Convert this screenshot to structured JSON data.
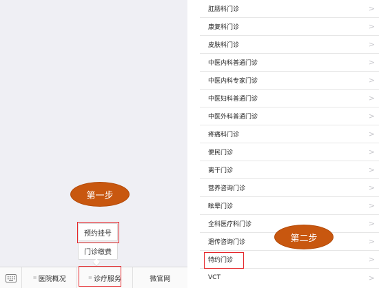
{
  "left_panel": {
    "popup_menu": {
      "items": [
        "预约挂号",
        "门诊缴费"
      ]
    },
    "menubar": {
      "keyboard_icon": "keyboard-icon",
      "items": [
        "医院概况",
        "诊疗服务",
        "微官网"
      ]
    },
    "step1_label": "第一步"
  },
  "right_panel": {
    "rows": [
      "肛肠科门诊",
      "康复科门诊",
      "皮肤科门诊",
      "中医内科普通门诊",
      "中医内科专家门诊",
      "中医妇科普通门诊",
      "中医外科普通门诊",
      "疼痛科门诊",
      "便民门诊",
      "离干门诊",
      "营养咨询门诊",
      "眩晕门诊",
      "全科医疗科门诊",
      "遗传咨询门诊",
      "特约门诊",
      "VCT"
    ],
    "step2_label": "第二步"
  },
  "colors": {
    "highlight": "#e5262a",
    "bubble": "#c8570f"
  }
}
